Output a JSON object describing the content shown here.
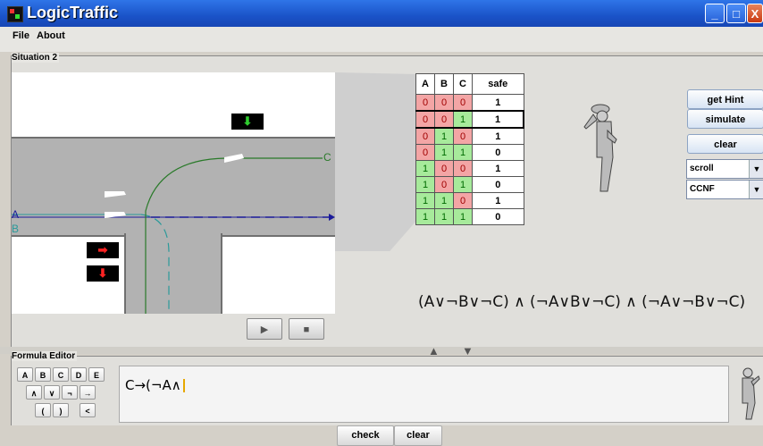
{
  "window": {
    "title": "LogicTraffic",
    "buttons": [
      "_",
      "□",
      "X"
    ]
  },
  "menu": {
    "items": [
      "File",
      "About"
    ]
  },
  "situation": {
    "label": "Situation 2",
    "lanes": {
      "a": "A",
      "b": "B",
      "c": "C"
    },
    "signs": [
      "arrow-down-icon",
      "arrow-right-icon",
      "arrow-down-icon"
    ],
    "controls": {
      "play": "▶",
      "stop": "■"
    }
  },
  "truth_table": {
    "headers": [
      "A",
      "B",
      "C",
      "safe"
    ],
    "rows": [
      [
        "0",
        "0",
        "0",
        "1"
      ],
      [
        "0",
        "0",
        "1",
        "1"
      ],
      [
        "0",
        "1",
        "0",
        "1"
      ],
      [
        "0",
        "1",
        "1",
        "0"
      ],
      [
        "1",
        "0",
        "0",
        "1"
      ],
      [
        "1",
        "0",
        "1",
        "0"
      ],
      [
        "1",
        "1",
        "0",
        "1"
      ],
      [
        "1",
        "1",
        "1",
        "0"
      ]
    ],
    "selected_row": 1
  },
  "side": {
    "get_hint": "get Hint",
    "simulate": "simulate",
    "clear": "clear",
    "mode": "scroll",
    "form": "CCNF"
  },
  "formula": "(A∨¬B∨¬C) ∧ (¬A∨B∨¬C) ∧ (¬A∨¬B∨¬C)",
  "editor": {
    "label": "Formula Editor",
    "keys_row1": [
      "A",
      "B",
      "C",
      "D",
      "E"
    ],
    "keys_row2": [
      "∧",
      "∨",
      "¬",
      "→"
    ],
    "keys_row3": [
      "(",
      ")",
      "<"
    ],
    "input_value": "C→(¬A∧"
  },
  "bottom": {
    "check": "check",
    "clear": "clear"
  }
}
